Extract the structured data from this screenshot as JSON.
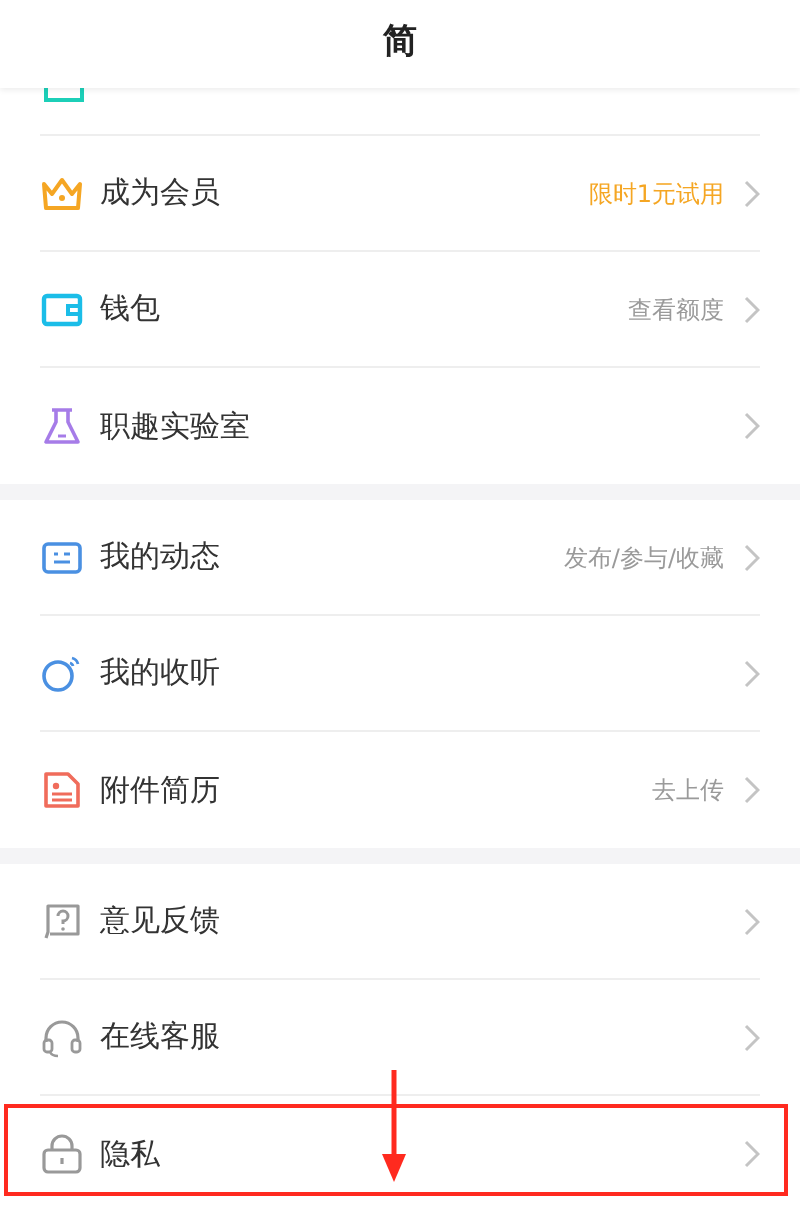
{
  "header": {
    "title": "简"
  },
  "top_cut_item": {
    "kind": "card"
  },
  "groups": [
    {
      "items": [
        {
          "kind": "crown",
          "label": "成为会员",
          "value": "限时1元试用",
          "accent": true,
          "highlighted": false
        },
        {
          "kind": "wallet",
          "label": "钱包",
          "value": "查看额度",
          "accent": false,
          "highlighted": false
        },
        {
          "kind": "flask",
          "label": "职趣实验室",
          "highlighted": false
        }
      ]
    },
    {
      "items": [
        {
          "kind": "feed",
          "label": "我的动态",
          "value": "发布/参与/收藏",
          "accent": false,
          "highlighted": false
        },
        {
          "kind": "listen",
          "label": "我的收听",
          "highlighted": false
        },
        {
          "kind": "resume",
          "label": "附件简历",
          "value": "去上传",
          "accent": false,
          "highlighted": false
        }
      ]
    },
    {
      "items": [
        {
          "kind": "feedback",
          "label": "意见反馈",
          "highlighted": false
        },
        {
          "kind": "headset",
          "label": "在线客服",
          "highlighted": false
        },
        {
          "kind": "lock",
          "label": "隐私",
          "highlighted": true
        }
      ]
    }
  ],
  "annotation": {
    "kind": "arrow_down"
  }
}
